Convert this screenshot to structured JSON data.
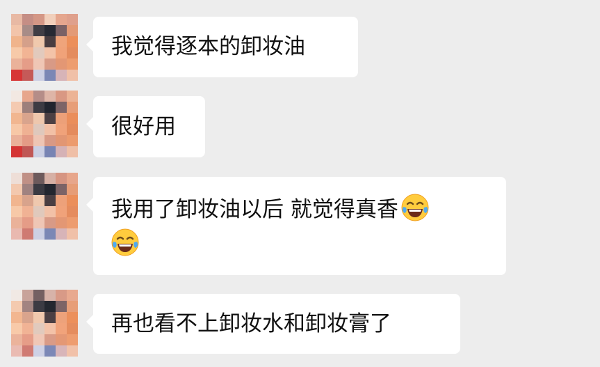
{
  "chat": {
    "messages": [
      {
        "text": "我觉得逐本的卸妆油"
      },
      {
        "text": "很好用"
      },
      {
        "text": "我用了卸妆油以后 就觉得真香",
        "emoji": "face-with-tears-of-joy"
      },
      {
        "text": "再也看不上卸妆水和卸妆膏了"
      }
    ]
  },
  "colors": {
    "background": "#ededed",
    "bubble": "#ffffff",
    "text": "#111111"
  }
}
